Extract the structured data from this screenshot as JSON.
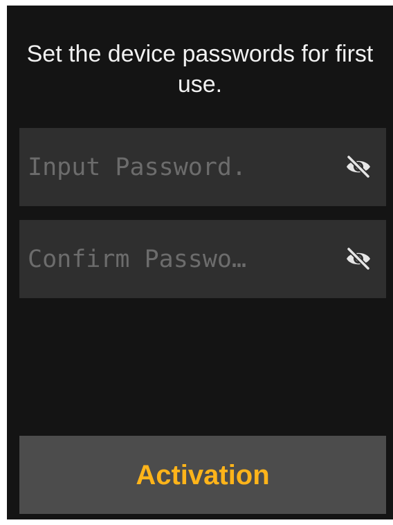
{
  "page": {
    "heading": "Set the device passwords for first use."
  },
  "fields": {
    "password": {
      "placeholder": "Input Password.",
      "value": "",
      "icon": "eye-slash-icon"
    },
    "confirm": {
      "placeholder": "Confirm Passwo…",
      "value": "",
      "icon": "eye-slash-icon"
    }
  },
  "actions": {
    "activate_label": "Activation"
  },
  "colors": {
    "background": "#141414",
    "field_background": "#2f2f2f",
    "button_background": "#4c4c4c",
    "accent": "#ffb41a",
    "placeholder": "#6c6c6c",
    "text": "#f2f2f2"
  }
}
